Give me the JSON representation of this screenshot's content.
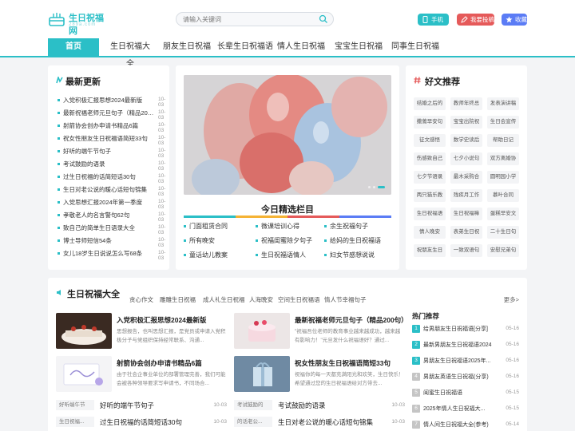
{
  "header": {
    "logo_text": "生日祝福网",
    "logo_sub": "289a.com",
    "search_placeholder": "请输入关键词",
    "buttons": [
      {
        "label": "手机端",
        "color": "#2bbfc7"
      },
      {
        "label": "我要投稿",
        "color": "#e55a5a"
      },
      {
        "label": "收藏",
        "color": "#5b7cf5"
      }
    ]
  },
  "nav": [
    "首页",
    "生日祝福大全",
    "朋友生日祝福",
    "长辈生日祝福语",
    "情人生日祝福",
    "宝宝生日祝福",
    "同事生日祝福"
  ],
  "latest": {
    "title": "最新更新",
    "items": [
      {
        "text": "入党积极汇报思想2024最新版",
        "date": "10-03"
      },
      {
        "text": "最新祝福老师元旦句子（精品200句）",
        "date": "10-03"
      },
      {
        "text": "射箭协会创办申请书精品6篇",
        "date": "10-03"
      },
      {
        "text": "祝女性朋友生日祝福语简短33句",
        "date": "10-03"
      },
      {
        "text": "好听的端午节句子",
        "date": "10-03"
      },
      {
        "text": "考试鼓励的语录",
        "date": "10-03"
      },
      {
        "text": "过生日祝福的话简短话30句",
        "date": "10-03"
      },
      {
        "text": "生日对老公说的暖心话短句锦集",
        "date": "10-03"
      },
      {
        "text": "入党思想汇报2024年第一季度",
        "date": "10-03"
      },
      {
        "text": "孝敬老人的名言警句62句",
        "date": "10-03"
      },
      {
        "text": "致自己的简单生日语录大全",
        "date": "10-03"
      },
      {
        "text": "博士导师短信54条",
        "date": "10-03"
      },
      {
        "text": "女儿18岁生日说说怎么写68条",
        "date": "10-03"
      }
    ]
  },
  "featured": {
    "section_title": "今日精选栏目",
    "picks": [
      "门面租赁合同",
      "微课培训心得",
      "余生祝福句子",
      "所有晚安",
      "祝福闺蜜除夕句子",
      "给妈的生日祝福语",
      "童话幼儿教案",
      "生日祝福语情人",
      "妇女节感想说说"
    ]
  },
  "recommend": {
    "title": "好文推荐",
    "tags": [
      "结婚之后的",
      "教师年终总",
      "发表演讲稿",
      "撒蔫早安句",
      "宝宝出院祝",
      "生日会宣传",
      "征文感悟",
      "数学史读后",
      "帮助日记",
      "伤感致自己",
      "七夕小说句",
      "双方离婚协",
      "七夕节语录",
      "最木采购合",
      "圆明园小学",
      "两只猫乐教",
      "残疾月工作",
      "慕叶合同",
      "生日祝福语",
      "生日祝福嘛",
      "蛋糕早安文",
      "情人晚安",
      "表弟生日祝",
      "二十生日句",
      "祝朋友生日",
      "一致双语句",
      "安慰兄弟句"
    ]
  },
  "bottom": {
    "title": "生日祝福大全",
    "tabs": [
      "贪心作文",
      "雕雕生日祝福",
      "成人礼生日祝福",
      "人海晚安",
      "空间生日祝福语",
      "情人节幸福句子"
    ],
    "more": "更多>",
    "features": [
      {
        "title": "入党积极汇报思想2024最新版",
        "desc": "思想报告，也叫思想汇报，是党员或申请入党积极分子与党组织保持经常联系、沟通..."
      },
      {
        "title": "最新祝福老师元旦句子（精品200句）",
        "desc": "\"祝福吾位老师的教育事业越来越成功，越来越有影响力！\"元旦发什么祝福语好？通过..."
      },
      {
        "title": "射箭协会创办申请书精品6篇",
        "desc": "由于社会企事业单位的部署管理完善，我们可能会被各种领导要求写申请书，不同场合..."
      },
      {
        "title": "祝女性朋友生日祝福语简短33句",
        "desc": "祝福你的每一天都充满阳光和欢笑，生日快乐！希望通过您的生日祝福语给对方带去..."
      }
    ],
    "list": [
      {
        "tag": "好听端午节",
        "text": "好听的端午节句子",
        "date": "10-03"
      },
      {
        "tag": "考试鼓励的",
        "text": "考试鼓励的语录",
        "date": "10-03"
      },
      {
        "tag": "生日祝福...",
        "text": "过生日祝福的话简短话30句",
        "date": "10-03"
      },
      {
        "tag": "的话老公...",
        "text": "生日对老公说的暖心话短句锦集",
        "date": "10-03"
      }
    ],
    "hot_title": "热门推荐",
    "hot": [
      {
        "text": "给男朋友生日祝福语[分享]",
        "date": "05-16"
      },
      {
        "text": "最新男朋友生日祝福语2024",
        "date": "05-16"
      },
      {
        "text": "男朋友生日祝福语2025年...",
        "date": "05-16"
      },
      {
        "text": "男朋友英语生日祝福(分享)",
        "date": "05-16"
      },
      {
        "text": "闺蜜生日祝福语",
        "date": "05-15"
      },
      {
        "text": "2025年情人生日祝福大...",
        "date": "05-15"
      },
      {
        "text": "情人间生日祝福大全(参考)",
        "date": "05-14"
      }
    ]
  },
  "colors": {
    "accent": "#2bbfc7",
    "red": "#e55a5a",
    "blue": "#5b7cf5"
  }
}
